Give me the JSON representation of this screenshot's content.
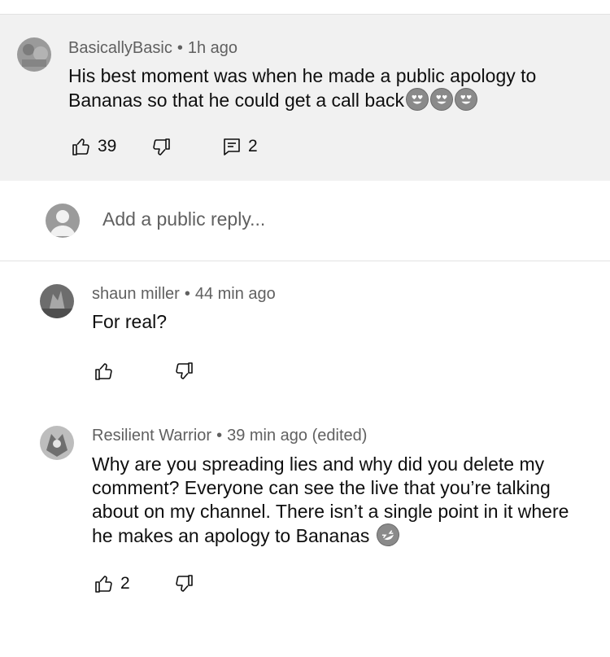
{
  "parent_comment": {
    "author": "BasicallyBasic",
    "separator": "•",
    "time": "1h ago",
    "text": "His best moment was when he made a public apology to Bananas so that he could get a call back",
    "emojis": [
      "heart-eyes-emoji",
      "heart-eyes-emoji",
      "heart-eyes-emoji"
    ],
    "likes": "39",
    "replies": "2"
  },
  "reply_box": {
    "placeholder": "Add a public reply..."
  },
  "replies": [
    {
      "author": "shaun miller",
      "separator": "•",
      "time": "44 min ago",
      "text": "For real?",
      "likes": ""
    },
    {
      "author": "Resilient Warrior",
      "separator": "•",
      "time": "39 min ago (edited)",
      "text": "Why are you spreading lies and why did you delete my comment? Everyone can see the live that you’re talking about on my channel. There isn’t a single point in it where he makes an apology to Bananas",
      "emoji": "rolling-laughing-emoji",
      "likes": "2"
    }
  ],
  "colors": {
    "parent_bg": "#f1f1f1",
    "meta_text": "#606060",
    "body_text": "#0f0f0f",
    "divider": "#e2e2e2"
  }
}
